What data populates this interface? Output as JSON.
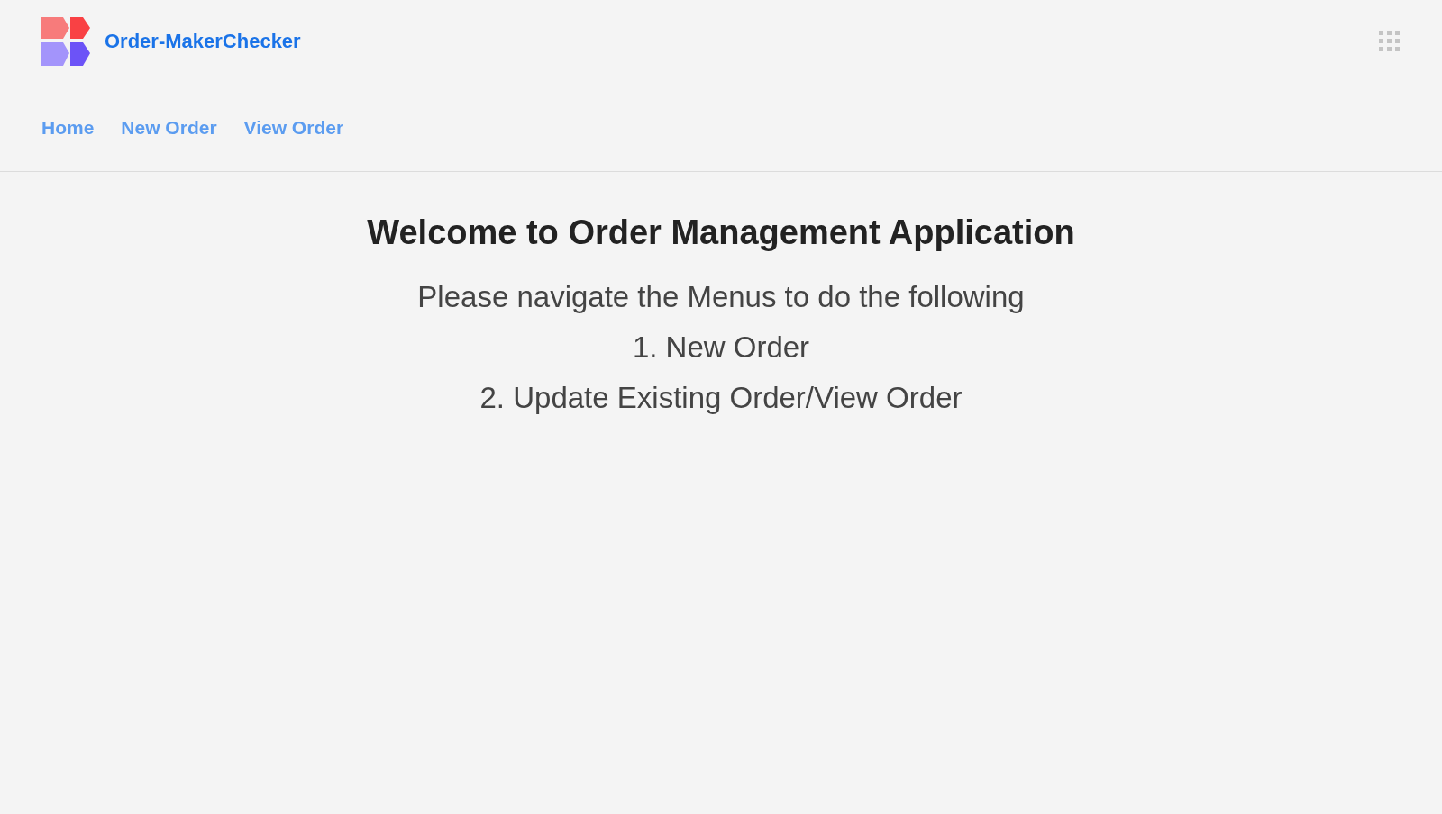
{
  "app": {
    "title": "Order-MakerChecker"
  },
  "nav": [
    {
      "label": "Home"
    },
    {
      "label": "New Order"
    },
    {
      "label": "View Order"
    }
  ],
  "content": {
    "heading": "Welcome to Order Management Application",
    "lines": [
      "Please navigate the Menus to do the following",
      "1. New Order",
      "2. Update Existing Order/View Order"
    ]
  }
}
